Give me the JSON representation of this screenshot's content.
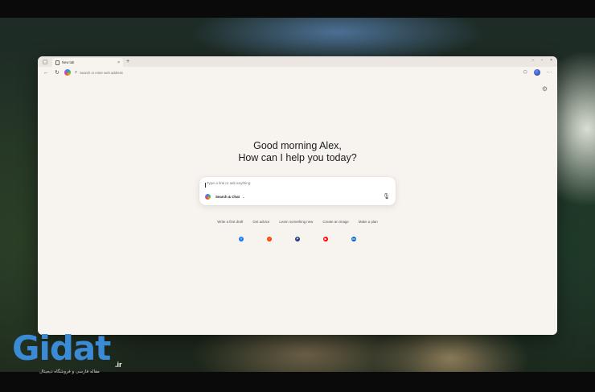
{
  "colors": {
    "accent": "#3b82f6",
    "window_bg": "#f7f3ef",
    "watermark": "#3b8ad6"
  },
  "browser": {
    "tab": {
      "title": "New tab",
      "favicon": "page-icon",
      "close_icon": "×"
    },
    "sidebar_toggle_icon": "▢",
    "new_tab_icon": "+",
    "window_controls": {
      "minimize": "–",
      "maximize": "▫",
      "close": "×"
    },
    "address_bar": {
      "back_icon": "←",
      "refresh_icon": "↻",
      "search_icon": "⌕",
      "placeholder": "Search or enter web address"
    },
    "toolbar": {
      "extension_icon": "⬡",
      "more_icon": "···"
    }
  },
  "page": {
    "settings_icon": "⚙",
    "greeting_line1": "Good morning Alex,",
    "greeting_line2": "How can I help you today?",
    "composer": {
      "placeholder": "Type a link or ask anything",
      "mode_label": "Search & Chat",
      "mode_chevron": "⌄",
      "mic_icon": "🎙"
    },
    "suggestions": [
      {
        "label": "Write a first draft"
      },
      {
        "label": "Get advice"
      },
      {
        "label": "Learn something new"
      },
      {
        "label": "Create an image"
      },
      {
        "label": "Make a plan"
      }
    ],
    "shortcuts": [
      {
        "name": "facebook",
        "glyph": "f",
        "color": "#1877f2"
      },
      {
        "name": "reddit",
        "glyph": "•",
        "color": "#ff4500"
      },
      {
        "name": "paypal",
        "glyph": "P",
        "color": "#253b80"
      },
      {
        "name": "youtube",
        "glyph": "▶",
        "color": "#ff0000"
      },
      {
        "name": "linkedin",
        "glyph": "in",
        "color": "#0a66c2"
      }
    ]
  },
  "watermark": {
    "text": "Gidat",
    "tld": ".ir",
    "subtitle": "مقاله فارسی و فروشگاه دیجیتال"
  }
}
